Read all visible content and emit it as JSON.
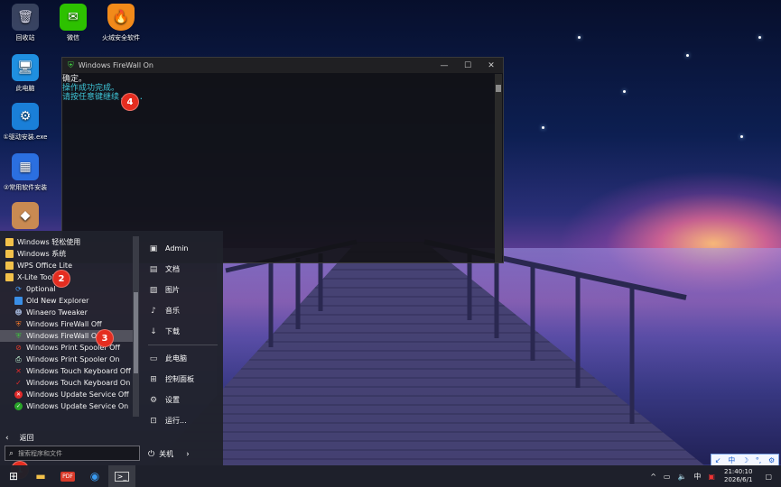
{
  "desktop_icons": [
    {
      "label": "回收站",
      "icon": "recycle-bin-icon"
    },
    {
      "label": "微信",
      "icon": "wechat-icon"
    },
    {
      "label": "火绒安全软件",
      "icon": "huorong-shield-icon"
    },
    {
      "label": "此电脑",
      "icon": "computer-icon"
    },
    {
      "label": "①驱动安装.exe",
      "icon": "driver-install-icon"
    },
    {
      "label": "②常用软件安装",
      "icon": "software-install-icon"
    },
    {
      "label": "",
      "icon": "x-lite-tools-icon"
    }
  ],
  "console": {
    "title": "Windows FireWall On",
    "lines": [
      "确定。",
      "操作成功完成。",
      "请按任意键继续. . ."
    ],
    "controls": {
      "minimize": "—",
      "maximize": "☐",
      "close": "✕"
    }
  },
  "badges": [
    "1",
    "2",
    "3",
    "4"
  ],
  "start_menu": {
    "programs": [
      {
        "label": "Windows 轻松使用",
        "icon": "folder-icon",
        "level": 0
      },
      {
        "label": "Windows 系统",
        "icon": "folder-icon",
        "level": 0
      },
      {
        "label": "WPS Office Lite",
        "icon": "folder-icon",
        "level": 0
      },
      {
        "label": "X-Lite Tool",
        "icon": "folder-icon",
        "level": 0
      },
      {
        "label": "0ptional",
        "icon": "optional-icon",
        "level": 1
      },
      {
        "label": "Old New Explorer",
        "icon": "explorer-icon",
        "level": 1
      },
      {
        "label": "Winaero Tweaker",
        "icon": "tweaker-icon",
        "level": 1
      },
      {
        "label": "Windows FireWall Off",
        "icon": "firewall-off-icon",
        "level": 1
      },
      {
        "label": "Windows FireWall On",
        "icon": "firewall-on-icon",
        "level": 1,
        "selected": true
      },
      {
        "label": "Windows Print Spooler Off",
        "icon": "spooler-off-icon",
        "level": 1
      },
      {
        "label": "Windows Print Spooler On",
        "icon": "printer-icon",
        "level": 1
      },
      {
        "label": "Windows Touch Keyboard Off",
        "icon": "cross-icon",
        "level": 1
      },
      {
        "label": "Windows Touch Keyboard On",
        "icon": "check-icon",
        "level": 1
      },
      {
        "label": "Windows Update Service Off",
        "icon": "update-off-icon",
        "level": 1
      },
      {
        "label": "Windows Update Service On",
        "icon": "update-on-icon",
        "level": 1
      }
    ],
    "back_label": "返回",
    "search_placeholder": "搜索程序和文件",
    "places": [
      {
        "label": "Admin",
        "icon": "user-icon"
      },
      {
        "label": "文档",
        "icon": "document-icon"
      },
      {
        "label": "图片",
        "icon": "picture-icon"
      },
      {
        "label": "音乐",
        "icon": "music-icon"
      },
      {
        "label": "下载",
        "icon": "download-icon"
      },
      {
        "label": "此电脑",
        "icon": "computer-icon"
      },
      {
        "label": "控制面板",
        "icon": "control-panel-icon"
      },
      {
        "label": "设置",
        "icon": "gear-icon"
      },
      {
        "label": "运行...",
        "icon": "run-icon"
      }
    ],
    "power_label": "关机"
  },
  "ime": [
    "中",
    "☽",
    "°,",
    "⚙"
  ],
  "taskbar": {
    "apps": [
      "start-icon",
      "file-explorer-icon",
      "pdf-icon",
      "browser-icon",
      "terminal-icon"
    ],
    "tray": {
      "chevron": "^",
      "ime_char": "中"
    },
    "time": "21:40:10",
    "date": "2026/6/1"
  },
  "colors": {
    "accent_red": "#e52d20",
    "console_cyan": "#3fc6d8"
  }
}
